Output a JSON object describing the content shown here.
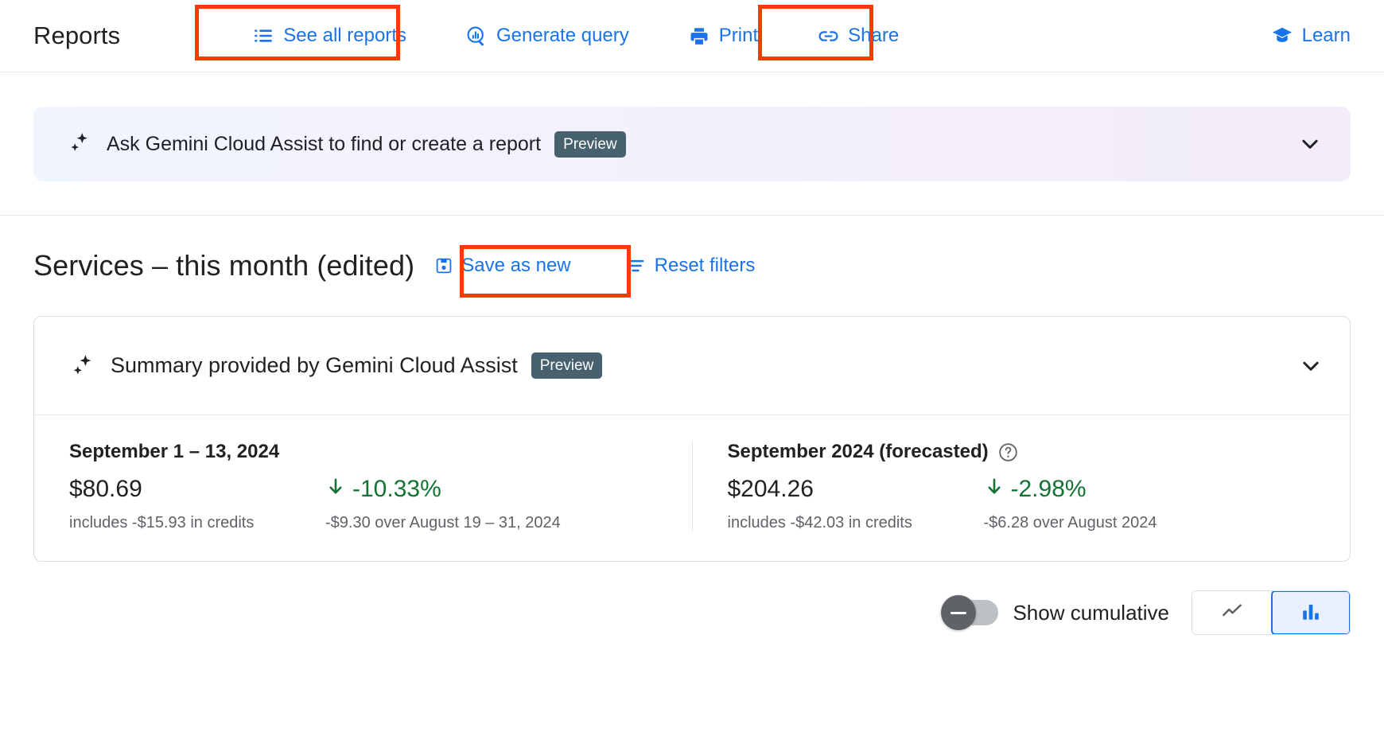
{
  "toolbar": {
    "title": "Reports",
    "actions": [
      {
        "label": "See all reports",
        "icon": "list-icon"
      },
      {
        "label": "Generate query",
        "icon": "query-search-icon"
      },
      {
        "label": "Print",
        "icon": "print-icon"
      },
      {
        "label": "Share",
        "icon": "link-share-icon"
      }
    ],
    "learn": {
      "label": "Learn",
      "icon": "school-icon"
    }
  },
  "banner": {
    "text": "Ask Gemini Cloud Assist to find or create a report",
    "badge": "Preview",
    "icon": "gemini-sparkle-icon",
    "expand_icon": "chevron-down-icon"
  },
  "report": {
    "title": "Services – this month (edited)",
    "save_as_new_label": "Save as new",
    "save_as_new_icon": "save-icon",
    "reset_filters_label": "Reset filters",
    "reset_filters_icon": "filter-tune-icon"
  },
  "summary_card": {
    "heading": "Summary provided by Gemini Cloud Assist",
    "badge": "Preview",
    "icon": "gemini-sparkle-icon",
    "expand_icon": "chevron-down-icon",
    "stats": [
      {
        "period": "September 1 – 13, 2024",
        "has_help_icon": false,
        "amount": "$80.69",
        "delta": "-10.33%",
        "delta_direction": "down",
        "credits": "includes -$15.93 in credits",
        "comparison": "-$9.30 over August 19 – 31, 2024"
      },
      {
        "period": "September 2024 (forecasted)",
        "has_help_icon": true,
        "help_icon": "help-circle-icon",
        "amount": "$204.26",
        "delta": "-2.98%",
        "delta_direction": "down",
        "credits": "includes -$42.03 in credits",
        "comparison": "-$6.28 over August 2024"
      }
    ]
  },
  "controls": {
    "cumulative_toggle_label": "Show cumulative",
    "cumulative_toggle_state": "off",
    "chart_types": [
      {
        "name": "line-chart",
        "icon": "line-chart-icon",
        "selected": false
      },
      {
        "name": "bar-chart",
        "icon": "bar-chart-icon",
        "selected": true
      }
    ]
  },
  "colors": {
    "accent_blue": "#1a73e8",
    "positive_green": "#137333",
    "badge_slate": "#47616e",
    "annotation_red": "#f93b00",
    "text_primary": "#202124",
    "text_secondary": "#5f6368"
  },
  "annotations": [
    {
      "target": "see-all-reports-button"
    },
    {
      "target": "share-button"
    },
    {
      "target": "save-as-new-button"
    }
  ]
}
